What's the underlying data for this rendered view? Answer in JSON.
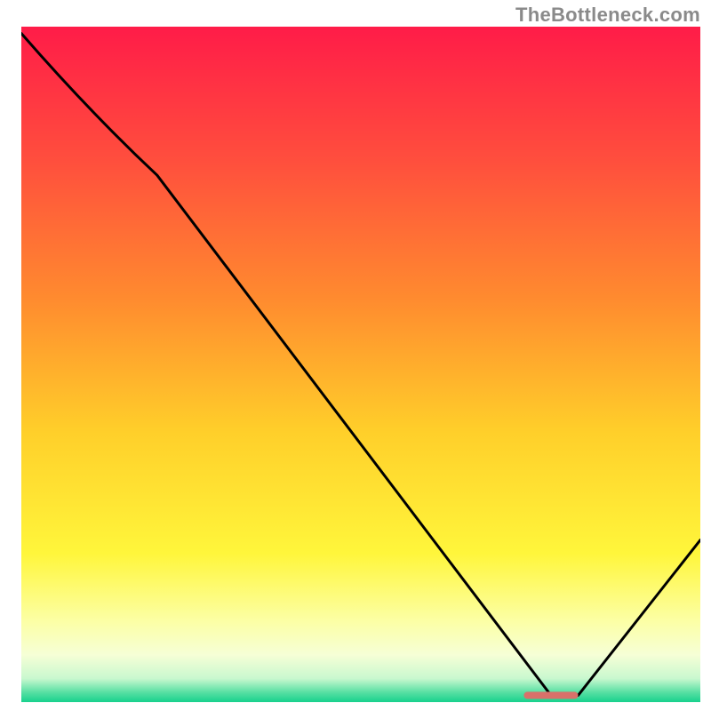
{
  "attribution": "TheBottleneck.com",
  "chart_data": {
    "type": "line",
    "title": "",
    "xlabel": "",
    "ylabel": "",
    "xlim": [
      0,
      100
    ],
    "ylim": [
      0,
      100
    ],
    "x": [
      0,
      20,
      78,
      82,
      100
    ],
    "y": [
      99,
      78,
      1,
      1,
      24
    ],
    "marker_segment": {
      "x_start": 74,
      "x_end": 82,
      "y": 1,
      "color": "#d9716a"
    },
    "gradient_stops": [
      {
        "offset": 0.0,
        "color": "#ff1c48"
      },
      {
        "offset": 0.2,
        "color": "#ff4f3d"
      },
      {
        "offset": 0.4,
        "color": "#ff8a2f"
      },
      {
        "offset": 0.6,
        "color": "#ffcf2a"
      },
      {
        "offset": 0.78,
        "color": "#fff63b"
      },
      {
        "offset": 0.88,
        "color": "#fcffa5"
      },
      {
        "offset": 0.93,
        "color": "#f6ffd6"
      },
      {
        "offset": 0.965,
        "color": "#c9f8cf"
      },
      {
        "offset": 0.985,
        "color": "#5ae0a4"
      },
      {
        "offset": 1.0,
        "color": "#18d18d"
      }
    ],
    "curve_color": "#000000",
    "curve_width": 3,
    "background_outside": "#000000"
  }
}
